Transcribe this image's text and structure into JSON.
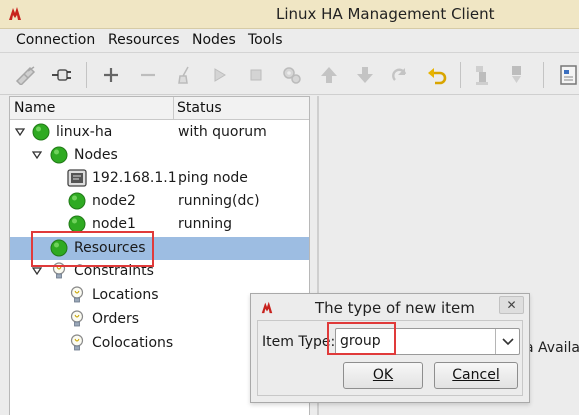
{
  "window": {
    "title": "Linux HA Management Client"
  },
  "menu": [
    "Connection",
    "Resources",
    "Nodes",
    "Tools"
  ],
  "toolbar": {
    "buttons": [
      "disconnect-icon",
      "connect-icon",
      "add-icon",
      "remove-icon",
      "clean-icon",
      "start-icon",
      "stop-icon",
      "settings-gears-icon",
      "move-up-icon",
      "move-down-icon",
      "redo-icon",
      "undo-icon",
      "standby-icon",
      "active-icon",
      "view-icon"
    ]
  },
  "tree": {
    "headers": {
      "name": "Name",
      "status": "Status"
    },
    "rows": [
      {
        "label": "linux-ha",
        "status": "with quorum",
        "icon": "green-status-icon"
      },
      {
        "label": "Nodes",
        "status": "",
        "icon": "green-status-icon"
      },
      {
        "label": "192.168.1.1",
        "status": "ping node",
        "icon": "ping-node-icon"
      },
      {
        "label": "node2",
        "status": "running(dc)",
        "icon": "green-status-icon"
      },
      {
        "label": "node1",
        "status": "running",
        "icon": "green-status-icon"
      },
      {
        "label": "Resources",
        "status": "",
        "icon": "green-status-icon",
        "selected": true
      },
      {
        "label": "Constraints",
        "status": "",
        "icon": "lightbulb-icon"
      },
      {
        "label": "Locations",
        "status": "",
        "icon": "lightbulb-icon"
      },
      {
        "label": "Orders",
        "status": "",
        "icon": "lightbulb-icon"
      },
      {
        "label": "Colocations",
        "status": "",
        "icon": "lightbulb-icon"
      }
    ]
  },
  "right_panel": {
    "partial_text": "a Availal"
  },
  "dialog": {
    "title": "The type of new item",
    "close": "✕",
    "item_type_label": "Item Type:",
    "item_type_value": "group",
    "ok_label": "OK",
    "cancel_label": "Cancel"
  },
  "colors": {
    "selection": "#9dbde2",
    "highlight": "#e03a3a",
    "status_green": "#2faa22",
    "titlebar": "#f0e6c4"
  }
}
